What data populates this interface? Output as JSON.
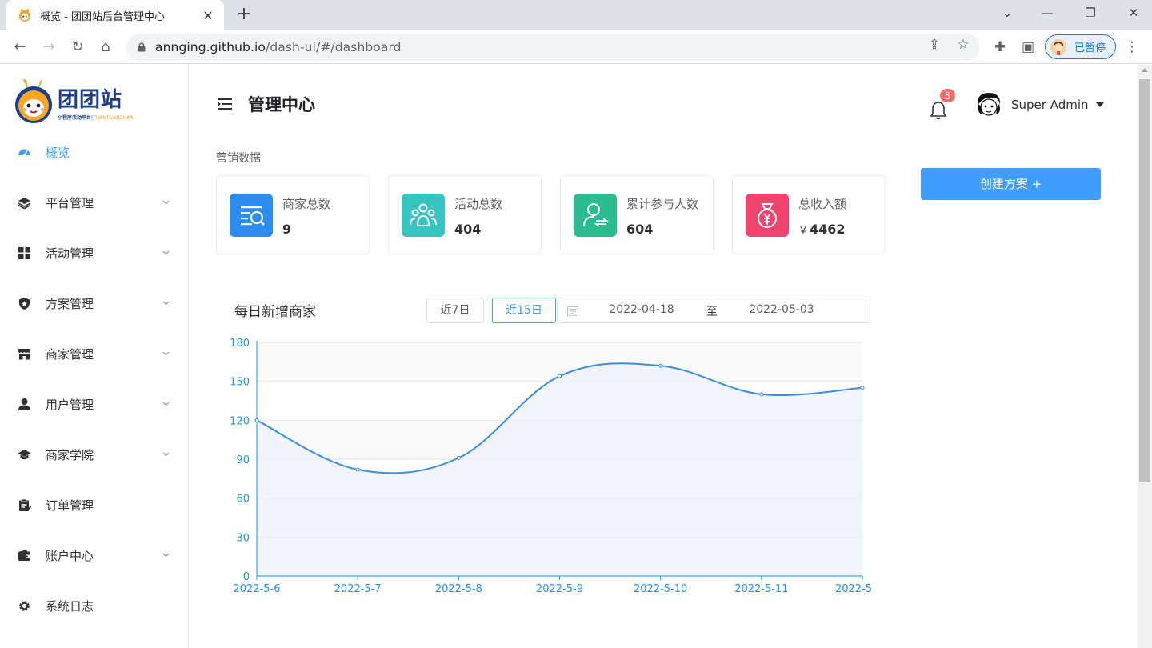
{
  "browser": {
    "tab_title": "概览 - 团团站后台管理中心",
    "url_host": "annging.github.io",
    "url_path": "/dash-ui/#/dashboard",
    "profile_label": "已暂停"
  },
  "sidebar": {
    "logo_title": "团团站",
    "logo_sub": "小程序活动平台",
    "logo_sub_en": "TUANTUANZHAN",
    "items": [
      {
        "label": "概览",
        "icon": "dashboard-icon",
        "active": true,
        "expandable": false
      },
      {
        "label": "平台管理",
        "icon": "layers-icon",
        "active": false,
        "expandable": true
      },
      {
        "label": "活动管理",
        "icon": "grid-icon",
        "active": false,
        "expandable": true
      },
      {
        "label": "方案管理",
        "icon": "shield-icon",
        "active": false,
        "expandable": true
      },
      {
        "label": "商家管理",
        "icon": "store-icon",
        "active": false,
        "expandable": true
      },
      {
        "label": "用户管理",
        "icon": "user-icon",
        "active": false,
        "expandable": true
      },
      {
        "label": "商家学院",
        "icon": "graduation-icon",
        "active": false,
        "expandable": true
      },
      {
        "label": "订单管理",
        "icon": "clipboard-icon",
        "active": false,
        "expandable": false
      },
      {
        "label": "账户中心",
        "icon": "wallet-icon",
        "active": false,
        "expandable": true
      },
      {
        "label": "系统日志",
        "icon": "gear-icon",
        "active": false,
        "expandable": false
      }
    ]
  },
  "header": {
    "title": "管理中心",
    "notification_count": "5",
    "user_name": "Super Admin"
  },
  "stats": {
    "section_label": "营销数据",
    "cards": [
      {
        "label": "商家总数",
        "value": "9",
        "icon": "search-list-icon",
        "color": "#2d8cf0"
      },
      {
        "label": "活动总数",
        "value": "404",
        "icon": "group-icon",
        "color": "#36c5c0"
      },
      {
        "label": "累计参与人数",
        "value": "604",
        "icon": "user-exchange-icon",
        "color": "#2bbd8f"
      },
      {
        "label": "总收入额",
        "value": "4462",
        "currency": "￥",
        "icon": "money-bag-icon",
        "color": "#f0436d"
      }
    ]
  },
  "actions": {
    "create_label": "创建方案 +"
  },
  "chart_panel": {
    "title": "每日新增商家",
    "range_7": "近7日",
    "range_15": "近15日",
    "date_start": "2022-04-18",
    "date_sep": "至",
    "date_end": "2022-05-03"
  },
  "chart_data": {
    "type": "area",
    "title": "每日新增商家",
    "categories": [
      "2022-5-6",
      "2022-5-7",
      "2022-5-8",
      "2022-5-9",
      "2022-5-10",
      "2022-5-11",
      "2022-5"
    ],
    "values": [
      120,
      82,
      91,
      154,
      162,
      140,
      145
    ],
    "ylim": [
      0,
      180
    ],
    "yticks": [
      0,
      30,
      60,
      90,
      120,
      150,
      180
    ],
    "grid": true,
    "smooth": true,
    "color": "#3a8ee6"
  }
}
